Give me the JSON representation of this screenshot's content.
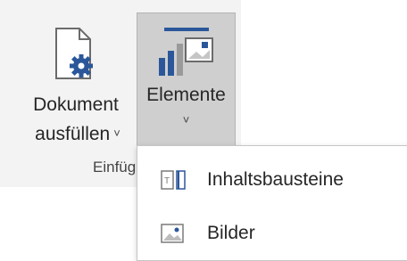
{
  "ribbon": {
    "dokument_button": {
      "label_line1": "Dokument",
      "label_line2": "ausfüllen",
      "chevron": "˅",
      "icon": "document-gear-icon"
    },
    "elemente_button": {
      "label": "Elemente",
      "chevron": "˅",
      "icon": "elements-icon",
      "state": "pressed"
    },
    "group_label": "Einfüg"
  },
  "dropdown": {
    "items": [
      {
        "label": "Inhaltsbausteine",
        "icon": "building-blocks-icon"
      },
      {
        "label": "Bilder",
        "icon": "picture-icon"
      }
    ]
  },
  "colors": {
    "ribbon_bg": "#f3f3f3",
    "pressed_bg": "#cfcfcf",
    "accent_blue": "#2b579a"
  }
}
